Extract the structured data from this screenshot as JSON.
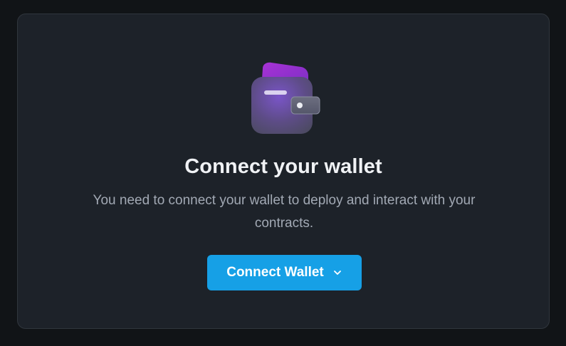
{
  "card": {
    "title": "Connect your wallet",
    "subtitle": "You need to connect your wallet to deploy and interact with your contracts."
  },
  "connect_button": {
    "label": "Connect Wallet",
    "icon": "chevron-down-icon"
  },
  "illustration": {
    "icon": "wallet-icon"
  },
  "colors": {
    "background": "#111417",
    "card": "#1d2229",
    "card_border": "#30363d",
    "title": "#f0f2f5",
    "subtitle": "#a2a9b4",
    "accent": "#16a0e6"
  }
}
